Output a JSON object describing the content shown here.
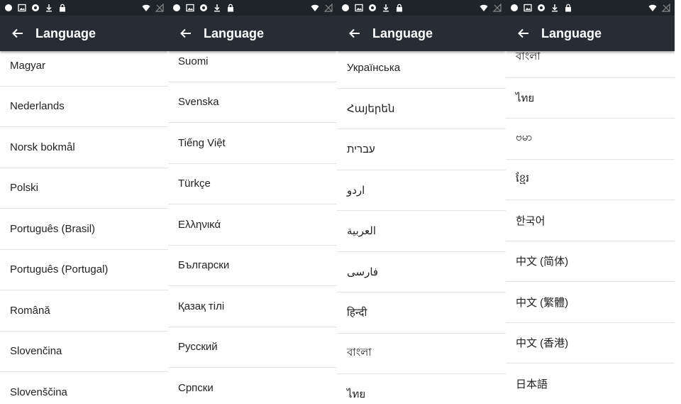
{
  "status_bar": {
    "left_icons": [
      "dot-icon",
      "image-icon",
      "sync-icon",
      "download-icon",
      "lock-icon"
    ],
    "right_icons": [
      "wifi-icon",
      "no-signal-icon"
    ]
  },
  "screens": [
    {
      "title": "Language",
      "items": [
        "Magyar",
        "Nederlands",
        "Norsk bokmål",
        "Polski",
        "Português (Brasil)",
        "Português (Portugal)",
        "Română",
        "Slovenčina",
        "Slovenščina"
      ]
    },
    {
      "title": "Language",
      "items": [
        "Suomi",
        "Svenska",
        "Tiếng Việt",
        "Türkçe",
        "Ελληνικά",
        "Български",
        "Қазақ тілі",
        "Русский",
        "Српски"
      ]
    },
    {
      "title": "Language",
      "items": [
        "Українська",
        "Հայերեն",
        "עברית",
        "اردو",
        "العربية",
        "فارسی",
        "हिन्दी",
        "বাংলা",
        "ไทย"
      ]
    },
    {
      "title": "Language",
      "items": [
        "বাংলা",
        "ไทย",
        "ဗမာ",
        "ខ្មែរ",
        "한국어",
        "中文 (简体)",
        "中文 (繁體)",
        "中文 (香港)",
        "日本語"
      ]
    }
  ],
  "colors": {
    "status_bar": "#1f2428",
    "app_bar": "#272d32",
    "divider": "#e3e3e3",
    "text": "#222222"
  }
}
